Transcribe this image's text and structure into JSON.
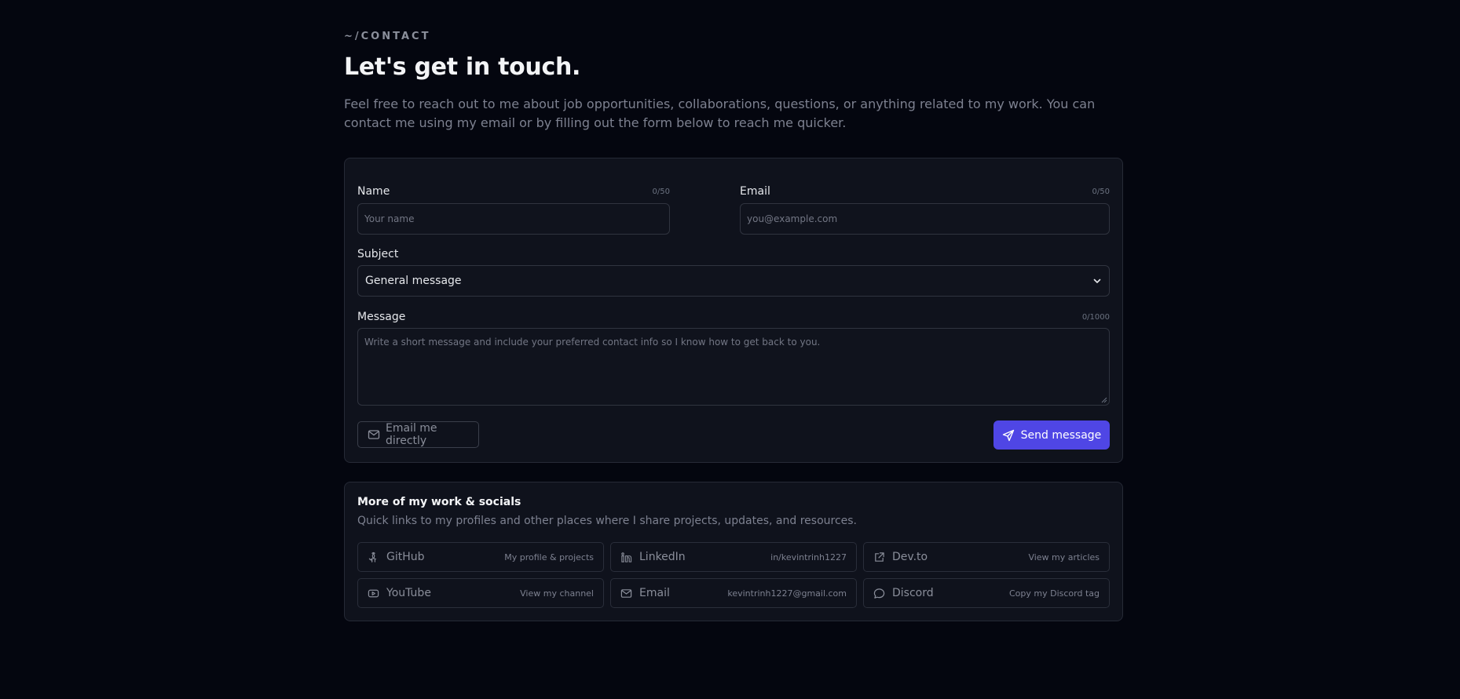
{
  "header": {
    "eyebrow": "~/CONTACT",
    "title": "Let's get in touch.",
    "intro": "Feel free to reach out to me about job opportunities, collaborations, questions, or anything related to my work. You can contact me using my email or by filling out the form below to reach me quicker."
  },
  "form": {
    "name": {
      "label": "Name",
      "counter": "0/50",
      "placeholder": "Your name"
    },
    "email": {
      "label": "Email",
      "counter": "0/50",
      "placeholder": "you@example.com"
    },
    "subject": {
      "label": "Subject",
      "selected": "General message"
    },
    "message": {
      "label": "Message",
      "counter": "0/1000",
      "placeholder": "Write a short message and include your preferred contact info so I know how to get back to you."
    },
    "email_direct_label": "Email me directly",
    "send_label": "Send message"
  },
  "socials": {
    "title": "More of my work & socials",
    "subtitle": "Quick links to my profiles and other places where I share projects, updates, and resources.",
    "items": [
      {
        "name": "GitHub",
        "desc": "My profile & projects",
        "icon": "github-icon"
      },
      {
        "name": "LinkedIn",
        "desc": "in/kevintrinh1227",
        "icon": "linkedin-icon"
      },
      {
        "name": "Dev.to",
        "desc": "View my articles",
        "icon": "external-link-icon"
      },
      {
        "name": "YouTube",
        "desc": "View my channel",
        "icon": "youtube-icon"
      },
      {
        "name": "Email",
        "desc": "kevintrinh1227@gmail.com",
        "icon": "mail-icon"
      },
      {
        "name": "Discord",
        "desc": "Copy my Discord tag",
        "icon": "chat-bubble-icon"
      }
    ]
  },
  "colors": {
    "background": "#04060f",
    "card": "#0f121c",
    "accent": "#4f46e5"
  }
}
